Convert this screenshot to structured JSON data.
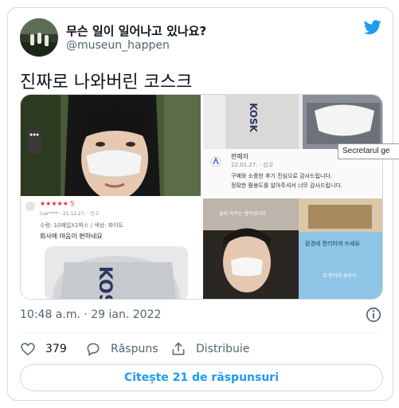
{
  "tweet": {
    "display_name": "무슨 일이 일어나고 있나요?",
    "handle": "@museun_happen",
    "text": "진짜로 나와버린 코스크",
    "timestamp": "10:48 a.m. · 29 ian. 2022"
  },
  "media": {
    "tile2": {
      "reviewer": "판매자",
      "date": "22.01.27. · 신고",
      "line1": "구매와 소중한 후기 진심으로 감사드립니다.",
      "line2": "정확한 활용도를 알아주셔서 너무 감사드립니다.",
      "brand": "KOSK"
    },
    "tile3": {
      "stars": "★★★★★ 5",
      "meta": "icar**** · 21.12.27. · 신고",
      "option": "수량: 10매입X1박스 / 색상: 화이트",
      "comment": "회사에 마음이 편하네요",
      "brand": "KOSK"
    },
    "tile4": {
      "bubble1": "숨이 막히는 생각입니다",
      "bubble2": "환경에 편리하게 쓰세요",
      "bubble3": "코 편하게 숨쉬기"
    }
  },
  "tooltip": {
    "text": "Secretarul ge"
  },
  "actions": {
    "likes_count": "379",
    "reply_label": "Răspuns",
    "share_label": "Distribuie"
  },
  "read_replies": {
    "label": "Citește 21 de răspunsuri"
  },
  "colors": {
    "accent": "#1d9bf0",
    "secondary_text": "#536471",
    "border": "#cfd9de"
  },
  "icons": {
    "brand": "twitter-bird-icon",
    "info": "info-icon",
    "like": "heart-icon",
    "reply": "reply-bubble-icon",
    "share": "share-icon"
  }
}
